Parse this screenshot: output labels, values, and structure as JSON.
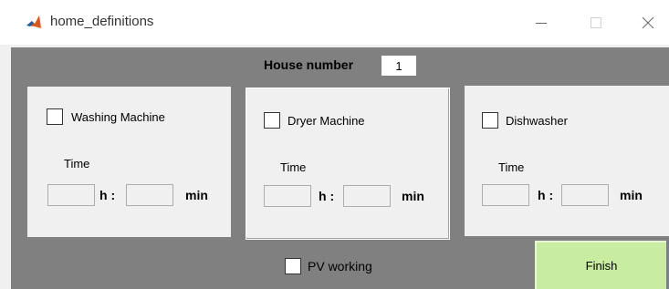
{
  "window": {
    "title": "home_definitions",
    "icon": "matlab-icon",
    "controls": [
      "minimize-icon",
      "maximize-icon",
      "close-icon"
    ]
  },
  "house": {
    "label": "House number",
    "value": "1"
  },
  "appliances": [
    {
      "label": "Washing Machine",
      "checked": false,
      "time_label": "Time",
      "hours_value": "",
      "hours_unit": "h :",
      "minutes_value": "",
      "minutes_unit": "min"
    },
    {
      "label": "Dryer Machine",
      "checked": false,
      "time_label": "Time",
      "hours_value": "",
      "hours_unit": "h :",
      "minutes_value": "",
      "minutes_unit": "min"
    },
    {
      "label": "Dishwasher",
      "checked": false,
      "time_label": "Time",
      "hours_value": "",
      "hours_unit": "h :",
      "minutes_value": "",
      "minutes_unit": "min"
    }
  ],
  "pv": {
    "label": "PV working",
    "checked": false
  },
  "finish": {
    "label": "Finish"
  },
  "colors": {
    "panel_background": "#808080",
    "finish_button": "#c9eda0",
    "group_background": "#f0f0f0"
  }
}
